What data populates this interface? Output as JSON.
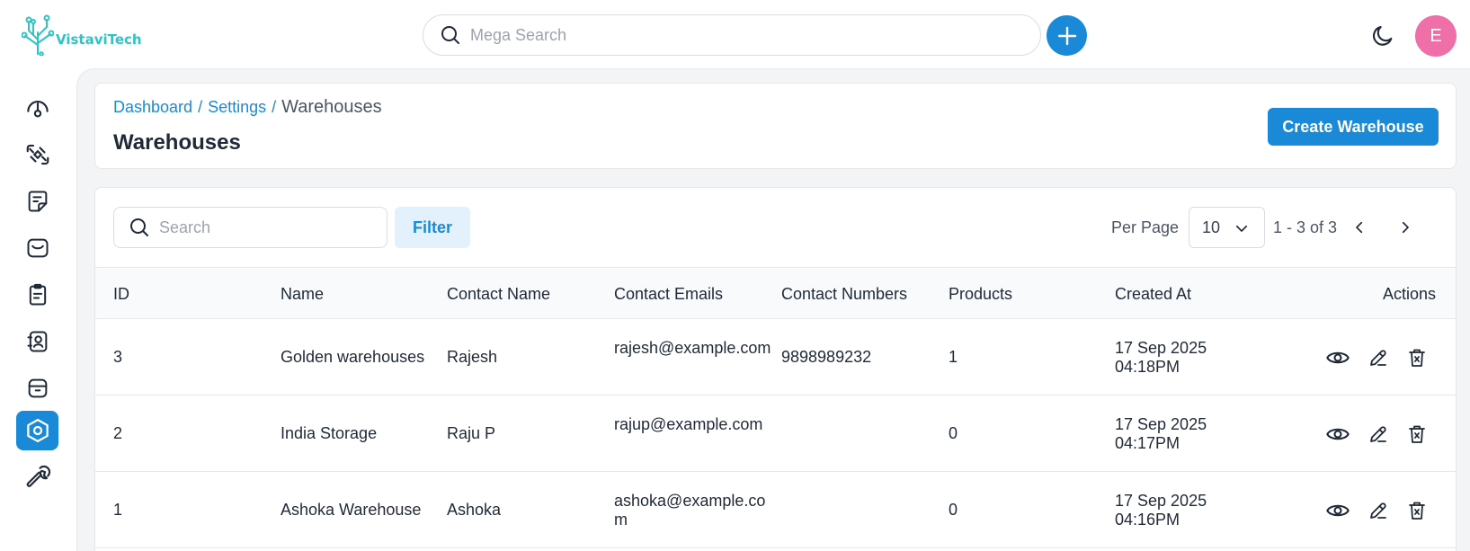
{
  "brand": {
    "name": "VistaviTech",
    "color": "#2ec4c6"
  },
  "topbar": {
    "search_placeholder": "Mega Search",
    "avatar_initial": "E",
    "avatar_color": "#ef6fa8"
  },
  "accent": "#1a8ad8",
  "sidebar": {
    "items": [
      {
        "icon": "dashboard-gauge-icon",
        "active": false
      },
      {
        "icon": "integrations-icon",
        "active": false
      },
      {
        "icon": "notes-icon",
        "active": false
      },
      {
        "icon": "inbox-icon",
        "active": false
      },
      {
        "icon": "orders-clipboard-icon",
        "active": false
      },
      {
        "icon": "contacts-icon",
        "active": false
      },
      {
        "icon": "archive-icon",
        "active": false
      },
      {
        "icon": "settings-hexagon-icon",
        "active": true
      },
      {
        "icon": "wrench-icon",
        "active": false
      }
    ]
  },
  "breadcrumb": {
    "item1": "Dashboard",
    "item2": "Settings",
    "current": "Warehouses",
    "separator": "/"
  },
  "page": {
    "title": "Warehouses",
    "create_button": "Create Warehouse"
  },
  "toolbar": {
    "search_placeholder": "Search",
    "filter_label": "Filter",
    "per_page_label": "Per Page",
    "per_page_value": "10",
    "page_range": "1 - 3 of 3"
  },
  "table": {
    "columns": [
      "ID",
      "Name",
      "Contact Name",
      "Contact Emails",
      "Contact Numbers",
      "Products",
      "Created At",
      "Actions"
    ],
    "rows": [
      {
        "id": "3",
        "name": "Golden warehouses",
        "contact_name": "Rajesh",
        "email": "rajesh@example.com",
        "number": "9898989232",
        "products": "1",
        "created_date": "17 Sep 2025",
        "created_time": "04:18PM"
      },
      {
        "id": "2",
        "name": "India Storage",
        "contact_name": "Raju P",
        "email": "rajup@example.com",
        "number": "",
        "products": "0",
        "created_date": "17 Sep 2025",
        "created_time": "04:17PM"
      },
      {
        "id": "1",
        "name": "Ashoka Warehouse",
        "contact_name": "Ashoka",
        "email": "ashoka@example.com",
        "number": "",
        "products": "0",
        "created_date": "17 Sep 2025",
        "created_time": "04:16PM"
      }
    ]
  }
}
